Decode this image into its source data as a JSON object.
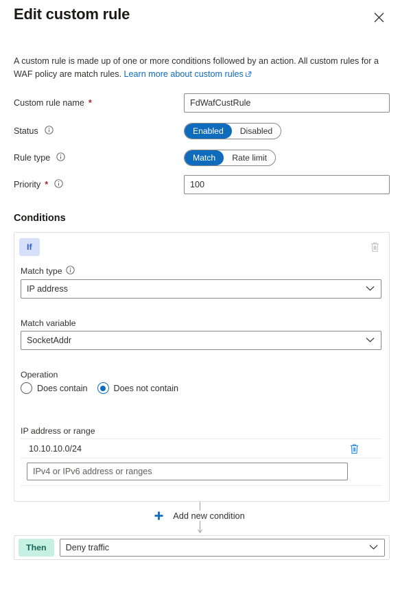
{
  "header": {
    "title": "Edit custom rule",
    "close_icon": "close-icon"
  },
  "intro": {
    "text_before_link": "A custom rule is made up of one or more conditions followed by an action. All custom rules for a WAF policy are match rules. ",
    "link_text": "Learn more about custom rules",
    "link_icon": "external-link-icon"
  },
  "form": {
    "rule_name": {
      "label": "Custom rule name",
      "required": "*",
      "value": "FdWafCustRule"
    },
    "status": {
      "label": "Status",
      "info_icon": "info-icon",
      "options": [
        "Enabled",
        "Disabled"
      ],
      "selected": "Enabled"
    },
    "rule_type": {
      "label": "Rule type",
      "info_icon": "info-icon",
      "options": [
        "Match",
        "Rate limit"
      ],
      "selected": "Match"
    },
    "priority": {
      "label": "Priority",
      "required": "*",
      "info_icon": "info-icon",
      "value": "100"
    }
  },
  "conditions": {
    "section_title": "Conditions",
    "badge_if": "If",
    "delete_condition_icon": "trash-icon",
    "match_type": {
      "label": "Match type",
      "info_icon": "info-icon",
      "value": "IP address"
    },
    "match_variable": {
      "label": "Match variable",
      "value": "SocketAddr"
    },
    "operation": {
      "label": "Operation",
      "options": [
        "Does contain",
        "Does not contain"
      ],
      "selected": "Does not contain"
    },
    "ip_section": {
      "label": "IP address or range",
      "entries": [
        "10.10.10.0/24"
      ],
      "delete_icon": "trash-icon",
      "new_entry_placeholder": "IPv4 or IPv6 address or ranges",
      "new_entry_value": ""
    }
  },
  "add_condition": {
    "label": "Add new condition",
    "icon": "plus-icon"
  },
  "action": {
    "badge_then": "Then",
    "value": "Deny traffic",
    "chevron_icon": "chevron-down-icon"
  },
  "colors": {
    "accent_blue": "#0f6cbd",
    "link_blue": "#0f6cbd",
    "required_red": "#a4262c",
    "if_badge_bg": "#d6e0fa",
    "if_badge_fg": "#2f5bc4",
    "then_badge_bg": "#c6f0e2",
    "then_badge_fg": "#17665a",
    "border_gray": "#8a8886"
  }
}
